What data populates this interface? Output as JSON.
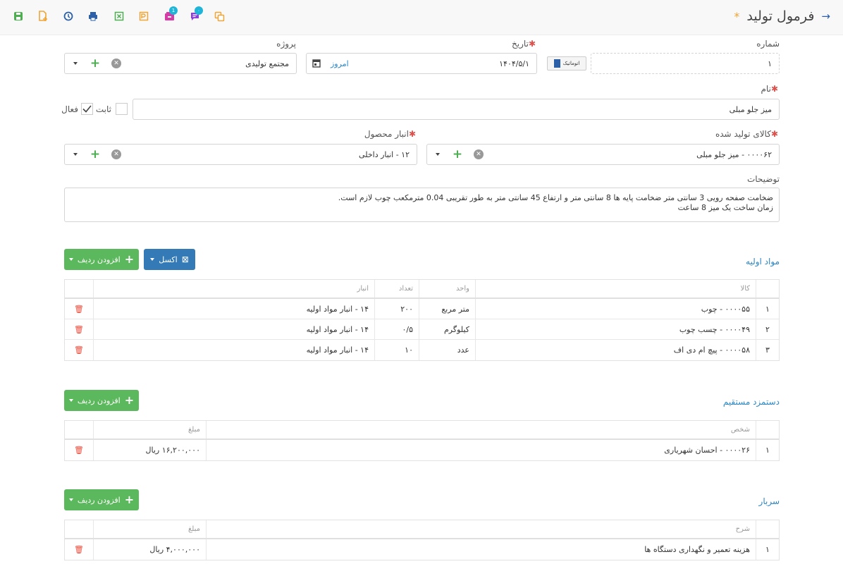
{
  "page": {
    "title": "فرمول تولید",
    "unsaved_mark": "*"
  },
  "toolbar": {
    "chat_badge": "۰",
    "inbox_badge": "1"
  },
  "form": {
    "number": {
      "label": "شماره",
      "value": "۱",
      "auto_label": "اتوماتیک"
    },
    "date": {
      "label": "تاریخ",
      "value": "۱۴۰۴/۵/۱",
      "today_label": "امروز"
    },
    "project": {
      "label": "پروژه",
      "value": "مجتمع تولیدی"
    },
    "name": {
      "label": "نام",
      "value": "میز جلو مبلی"
    },
    "fixed": {
      "label": "ثابت",
      "checked": false
    },
    "active": {
      "label": "فعال",
      "checked": true
    },
    "product": {
      "label": "کالای تولید شده",
      "value": "۰۰۰۰۶۲ - میز جلو مبلی"
    },
    "warehouse": {
      "label": "انبار محصول",
      "value": "۱۲ - انبار داخلی"
    },
    "description": {
      "label": "توضیحات",
      "line1": "ضخامت صفحه رویی 3 سانتی متر ضخامت پایه ها 8 سانتی متر و ارتفاع 45 سانتی متر به طور تقریبی 0.04 مترمکعب چوب لازم است.",
      "line2": "زمان ساخت یک میز 8 ساعت"
    }
  },
  "buttons": {
    "add_row": "افزودن ردیف",
    "excel": "اکسل"
  },
  "materials": {
    "title": "مواد اولیه",
    "headers": {
      "item": "کالا",
      "unit": "واحد",
      "qty": "تعداد",
      "warehouse": "انبار"
    },
    "rows": [
      {
        "n": "۱",
        "item": "۰۰۰۰۵۵ - چوب",
        "unit": "متر مربع",
        "qty": "۲۰۰",
        "warehouse": "۱۴ - انبار مواد اولیه"
      },
      {
        "n": "۲",
        "item": "۰۰۰۰۴۹ - چسب چوب",
        "unit": "کیلوگرم",
        "qty": "۰/۵",
        "warehouse": "۱۴ - انبار مواد اولیه"
      },
      {
        "n": "۳",
        "item": "۰۰۰۰۵۸ - پیچ ام دی اف",
        "unit": "عدد",
        "qty": "۱۰",
        "warehouse": "۱۴ - انبار مواد اولیه"
      }
    ]
  },
  "labor": {
    "title": "دستمزد مستقیم",
    "headers": {
      "person": "شخص",
      "amount": "مبلغ"
    },
    "rows": [
      {
        "n": "۱",
        "person": "۰۰۰۰۲۶ - احسان شهریاری",
        "amount": "۱۶,۲۰۰,۰۰۰ ریال"
      }
    ]
  },
  "overhead": {
    "title": "سربار",
    "headers": {
      "desc": "شرح",
      "amount": "مبلغ"
    },
    "rows": [
      {
        "n": "۱",
        "desc": "هزینه تعمیر و نگهداری دستگاه ها",
        "amount": "۴,۰۰۰,۰۰۰ ریال"
      }
    ]
  },
  "colors": {
    "accent": "#2b86c5",
    "green": "#5cb85c",
    "blue": "#337ab7",
    "danger": "#e74c3c",
    "star": "#f0a534"
  }
}
